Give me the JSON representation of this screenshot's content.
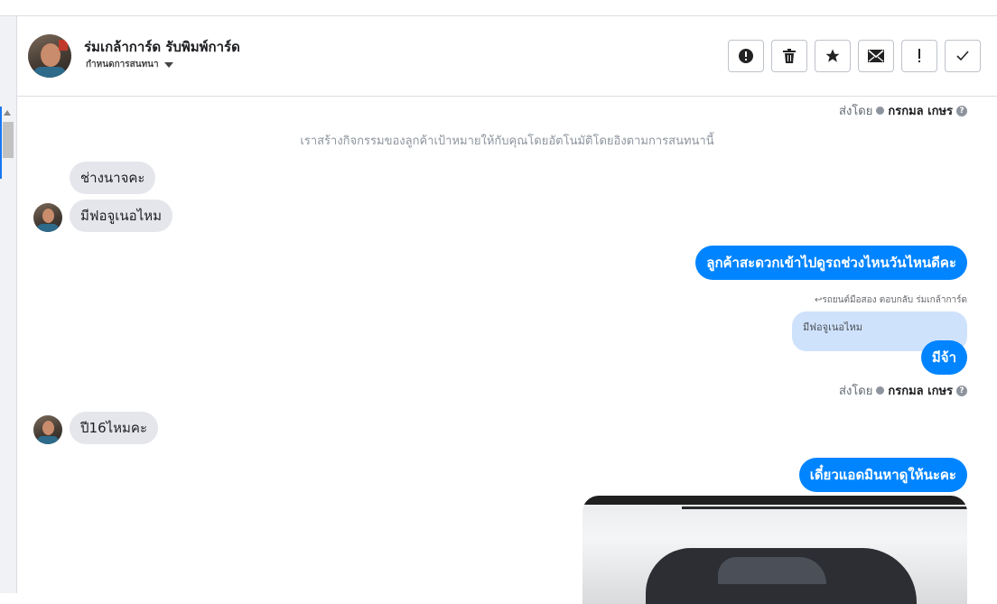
{
  "header": {
    "contact_name": "ร่มเกล้าการ์ด รับพิมพ์การ์ด",
    "subtitle": "กำหนดการสนทนา",
    "toolbar": [
      {
        "name": "report-icon",
        "glyph": "!"
      },
      {
        "name": "trash-icon",
        "glyph": "🗑"
      },
      {
        "name": "star-icon",
        "glyph": "★"
      },
      {
        "name": "mail-icon",
        "glyph": "✉"
      },
      {
        "name": "exclamation-icon",
        "glyph": "!"
      },
      {
        "name": "check-icon",
        "glyph": "✓"
      }
    ]
  },
  "conversation": {
    "sent_by_label": "ส่งโดย",
    "sent_by_name": "กรกมล เกษร",
    "system_note": "เราสร้างกิจกรรมของลูกค้าเป้าหมายให้กับคุณโดยอัตโนมัติโดยอิงตามการสนทนานี้",
    "msg_in_1": "ช่างนาจคะ",
    "msg_in_2": "มีฟอจูเนอไหม",
    "msg_out_1": "ลูกค้าสะดวกเข้าไปดูรถช่วงไหนวันไหนดีคะ",
    "reply_note": "↩รถยนต์มือสอง ตอบกลับ ร่มเกล้าการ์ด",
    "quoted_text": "มีฟอจูเนอไหม",
    "msg_out_2": "มีจ้า",
    "msg_in_3": "ปี16ไหมคะ",
    "msg_out_3": "เดี๋ยวแอดมินหาดูให้นะคะ"
  },
  "colors": {
    "accent": "#0084ff",
    "incoming_bubble": "#e4e6eb",
    "quoted_bubble": "#cfe2fc"
  }
}
